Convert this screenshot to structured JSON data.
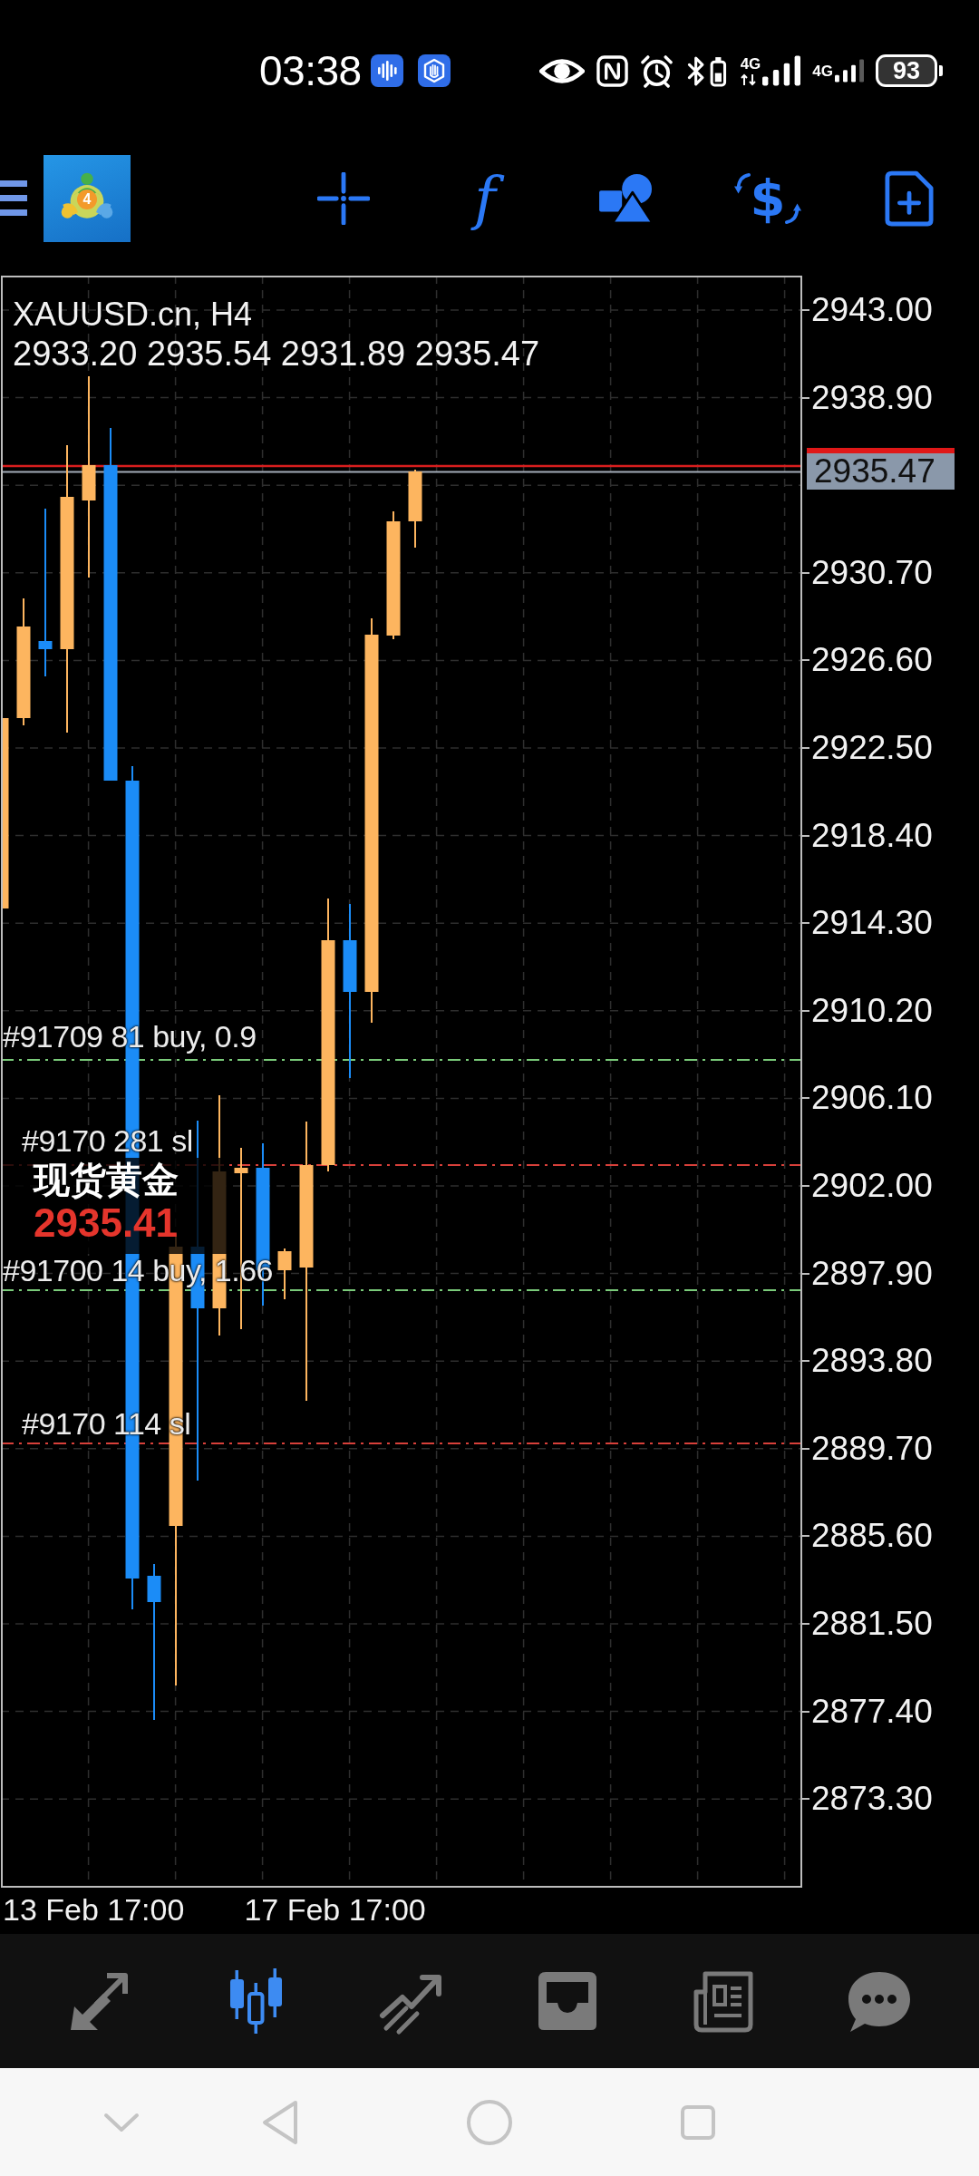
{
  "status_bar": {
    "time": "03:38",
    "sim_1_network": "4G",
    "sim_2_network": "4G",
    "battery": "93"
  },
  "toolbar": {
    "logo_badge": "4",
    "function_button": "f",
    "currency_button": "$"
  },
  "chart": {
    "symbol": "XAUUSD.cn, H4",
    "ohlc": "2933.20 2935.54 2931.89 2935.47",
    "price_labels": [
      "2943.00",
      "2938.90",
      "2930.70",
      "2926.60",
      "2922.50",
      "2918.40",
      "2914.30",
      "2910.20",
      "2906.10",
      "2902.00",
      "2897.90",
      "2893.80",
      "2889.70",
      "2885.60",
      "2881.50",
      "2877.40",
      "2873.30"
    ],
    "current_price": "2935.47",
    "time_labels": [
      "13 Feb 17:00",
      "17 Feb 17:00"
    ],
    "orders": [
      {
        "label": "#91709 81 buy, 0.9",
        "kind": "buy"
      },
      {
        "label": "#9170 281 sl",
        "kind": "sl"
      },
      {
        "label": "#91700 14 buy, 1.66",
        "kind": "buy"
      },
      {
        "label": "#9170 114 sl",
        "kind": "sl"
      }
    ],
    "ticker_overlay": {
      "name": "现货黄金",
      "price": "2935.41"
    }
  },
  "bottom_nav": [
    {
      "selected": false
    },
    {
      "selected": true
    },
    {
      "selected": false
    },
    {
      "selected": false
    },
    {
      "selected": false
    },
    {
      "selected": false
    }
  ]
}
